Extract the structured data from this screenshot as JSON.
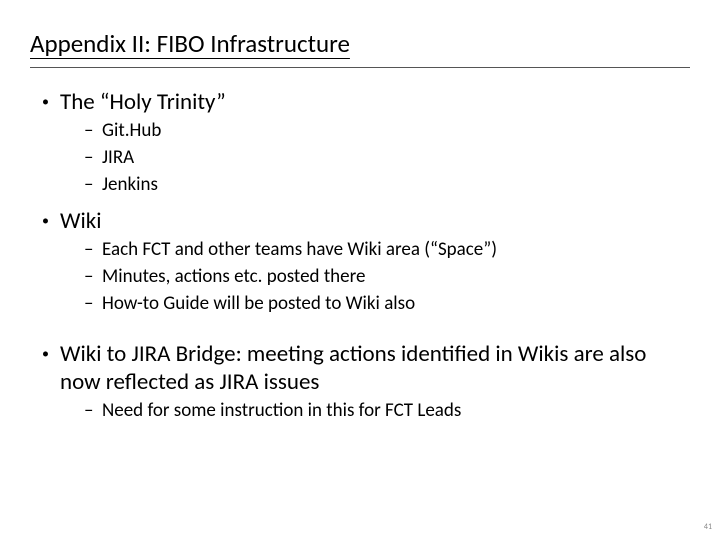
{
  "title": "Appendix II: FIBO Infrastructure",
  "sections": [
    {
      "heading": "The “Holy Trinity”",
      "items": [
        "Git.Hub",
        "JIRA",
        "Jenkins"
      ],
      "gap": false
    },
    {
      "heading": "Wiki",
      "items": [
        "Each FCT and other teams have Wiki area (“Space”)",
        "Minutes, actions etc. posted there",
        "How-to Guide will be posted to Wiki also"
      ],
      "gap": false
    },
    {
      "heading": "Wiki to JIRA Bridge: meeting actions identified in Wikis are also now reflected as JIRA issues",
      "items": [
        "Need for some instruction in this for FCT Leads"
      ],
      "gap": true
    }
  ],
  "page_number": "41"
}
